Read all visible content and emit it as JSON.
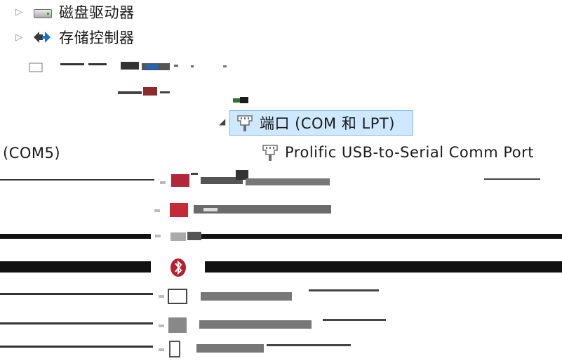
{
  "tree": {
    "disk_drives_label": "磁盘驱动器",
    "storage_controllers_label": "存储控制器",
    "ports_label": "端口 (COM 和 LPT)",
    "com5_suffix": "(COM5)",
    "prolific_device_label": "Prolific USB-to-Serial Comm Port"
  },
  "colors": {
    "selection_bg": "#cde8ff",
    "selection_border": "#7eb4ea"
  },
  "icons": {
    "disk": "disk-drive-icon",
    "storage": "storage-controller-icon",
    "port": "port-connector-icon"
  }
}
